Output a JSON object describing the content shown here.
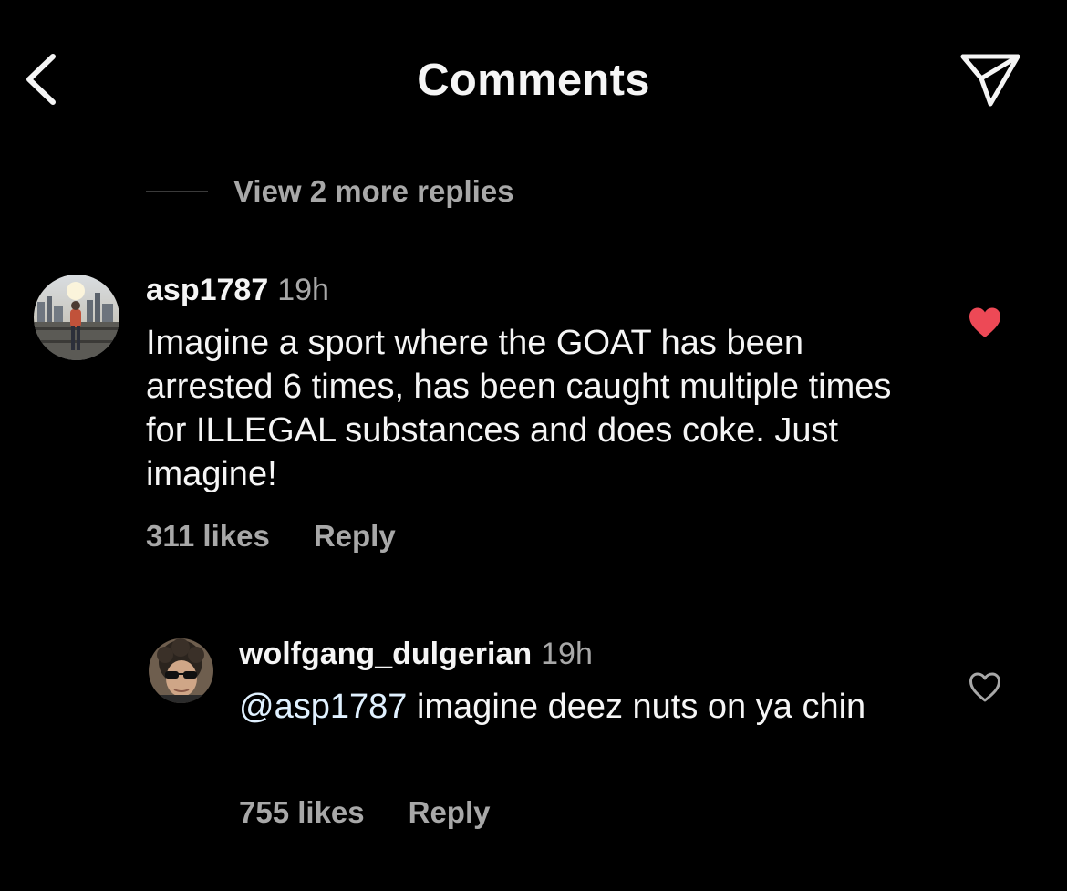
{
  "header": {
    "title": "Comments",
    "back_icon": "chevron-left-icon",
    "share_icon": "paper-plane-icon"
  },
  "view_more": {
    "label": "View 2 more replies"
  },
  "comments": [
    {
      "username": "asp1787",
      "time": "19h",
      "text": "Imagine a sport where the GOAT has been arrested 6 times, has been caught multiple times for ILLEGAL substances and does coke. Just imagine!",
      "likes": "311 likes",
      "reply_label": "Reply",
      "liked": true,
      "heart_color": "#ed4956"
    },
    {
      "username": "wolfgang_dulgerian",
      "time": "19h",
      "mention": "@asp1787",
      "text": " imagine deez nuts on ya chin",
      "likes": "755 likes",
      "reply_label": "Reply",
      "liked": false
    }
  ],
  "colors": {
    "background": "#000000",
    "primary_text": "#f5f5f5",
    "secondary_text": "#a8a8a8",
    "like_red": "#ed4956",
    "mention": "#e0f1ff"
  }
}
